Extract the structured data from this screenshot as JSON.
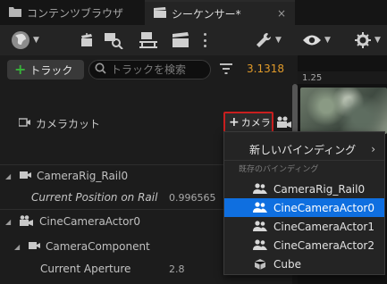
{
  "tabs": {
    "content_browser": "コンテンツブラウザ",
    "sequencer": "シーケンサー*",
    "sequencer_close": "×"
  },
  "toolbar": {
    "icons": [
      "world-icon",
      "actor-icon",
      "camera-search-icon",
      "rail-icon",
      "clapperboard-icon",
      "more-icon",
      "wrench-icon",
      "eye-icon",
      "snap-icon"
    ]
  },
  "filter": {
    "track_label": "トラック",
    "search_placeholder": "トラックを検索",
    "time": "3.1318"
  },
  "timeline": {
    "ruler_label": "1.25"
  },
  "camera_cut": {
    "label": "カメラカット",
    "add_label": "カメラ"
  },
  "tree": [
    {
      "label": "CameraRig_Rail0"
    },
    {
      "label": "Current Position on Rail",
      "value": "0.996565"
    },
    {
      "label": "CineCameraActor0"
    },
    {
      "label": "CameraComponent"
    },
    {
      "label": "Current Aperture",
      "value": "2.8"
    }
  ],
  "menu": {
    "new_binding": "新しいバインディング",
    "section": "既存のバインディング",
    "items": [
      {
        "label": "CameraRig_Rail0",
        "icon": "people-icon",
        "selected": false
      },
      {
        "label": "CineCameraActor0",
        "icon": "people-icon",
        "selected": true
      },
      {
        "label": "CineCameraActor1",
        "icon": "people-icon",
        "selected": false
      },
      {
        "label": "CineCameraActor2",
        "icon": "people-icon",
        "selected": false
      },
      {
        "label": "Cube",
        "icon": "cube-icon",
        "selected": false
      }
    ]
  },
  "colors": {
    "accent_selected": "#0f6fe0",
    "highlight_border": "#c81f1f",
    "time_value": "#e09a2a",
    "add_green": "#38b23a"
  }
}
